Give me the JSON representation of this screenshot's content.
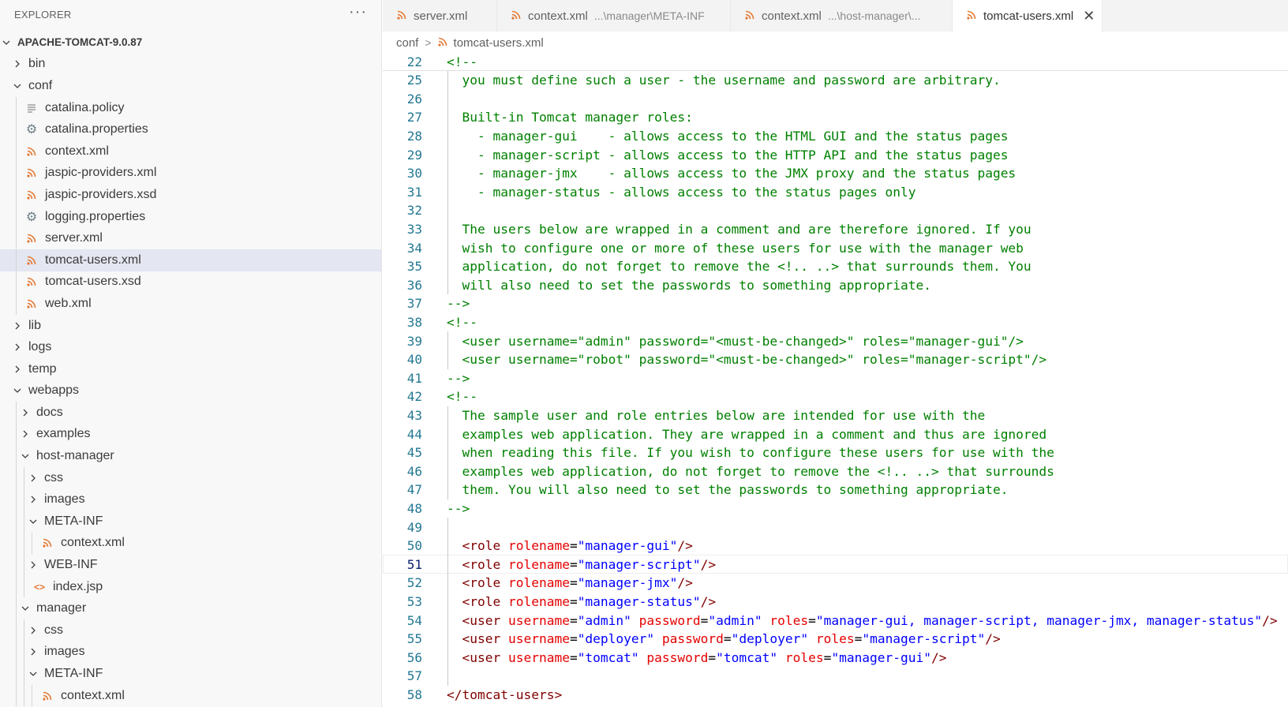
{
  "explorer": {
    "title": "EXPLORER",
    "more_label": "···",
    "items": [
      {
        "label": "APACHE-TOMCAT-9.0.87",
        "depth": 0,
        "type": "folder-open",
        "root": true
      },
      {
        "label": "bin",
        "depth": 1,
        "type": "folder-closed"
      },
      {
        "label": "conf",
        "depth": 1,
        "type": "folder-open"
      },
      {
        "label": "catalina.policy",
        "depth": 2,
        "type": "file",
        "icon": "lines-icon"
      },
      {
        "label": "catalina.properties",
        "depth": 2,
        "type": "file",
        "icon": "gear-icon"
      },
      {
        "label": "context.xml",
        "depth": 2,
        "type": "file",
        "icon": "rss-icon"
      },
      {
        "label": "jaspic-providers.xml",
        "depth": 2,
        "type": "file",
        "icon": "rss-icon"
      },
      {
        "label": "jaspic-providers.xsd",
        "depth": 2,
        "type": "file",
        "icon": "rss-icon"
      },
      {
        "label": "logging.properties",
        "depth": 2,
        "type": "file",
        "icon": "gear-icon"
      },
      {
        "label": "server.xml",
        "depth": 2,
        "type": "file",
        "icon": "rss-icon"
      },
      {
        "label": "tomcat-users.xml",
        "depth": 2,
        "type": "file",
        "icon": "rss-icon",
        "selected": true
      },
      {
        "label": "tomcat-users.xsd",
        "depth": 2,
        "type": "file",
        "icon": "rss-icon"
      },
      {
        "label": "web.xml",
        "depth": 2,
        "type": "file",
        "icon": "rss-icon"
      },
      {
        "label": "lib",
        "depth": 1,
        "type": "folder-closed"
      },
      {
        "label": "logs",
        "depth": 1,
        "type": "folder-closed"
      },
      {
        "label": "temp",
        "depth": 1,
        "type": "folder-closed"
      },
      {
        "label": "webapps",
        "depth": 1,
        "type": "folder-open"
      },
      {
        "label": "docs",
        "depth": 2,
        "type": "folder-closed"
      },
      {
        "label": "examples",
        "depth": 2,
        "type": "folder-closed"
      },
      {
        "label": "host-manager",
        "depth": 2,
        "type": "folder-open"
      },
      {
        "label": "css",
        "depth": 3,
        "type": "folder-closed"
      },
      {
        "label": "images",
        "depth": 3,
        "type": "folder-closed"
      },
      {
        "label": "META-INF",
        "depth": 3,
        "type": "folder-open"
      },
      {
        "label": "context.xml",
        "depth": 4,
        "type": "file",
        "icon": "rss-icon"
      },
      {
        "label": "WEB-INF",
        "depth": 3,
        "type": "folder-closed"
      },
      {
        "label": "index.jsp",
        "depth": 3,
        "type": "file",
        "icon": "code-icon"
      },
      {
        "label": "manager",
        "depth": 2,
        "type": "folder-open"
      },
      {
        "label": "css",
        "depth": 3,
        "type": "folder-closed"
      },
      {
        "label": "images",
        "depth": 3,
        "type": "folder-closed"
      },
      {
        "label": "META-INF",
        "depth": 3,
        "type": "folder-open"
      },
      {
        "label": "context.xml",
        "depth": 4,
        "type": "file",
        "icon": "rss-icon"
      }
    ]
  },
  "tabs": [
    {
      "label": "server.xml",
      "description": "",
      "active": false
    },
    {
      "label": "context.xml",
      "description": "...\\manager\\META-INF",
      "active": false
    },
    {
      "label": "context.xml",
      "description": "...\\host-manager\\...",
      "active": false
    },
    {
      "label": "tomcat-users.xml",
      "description": "",
      "active": true,
      "close": "✕"
    }
  ],
  "breadcrumb": {
    "folder": "conf",
    "separator": ">",
    "file": "tomcat-users.xml"
  },
  "editor": {
    "sticky": {
      "num": "22",
      "segments": [
        {
          "t": "<!--",
          "c": "green"
        }
      ]
    },
    "current_line": "51",
    "lines": [
      {
        "num": "25",
        "segments": [
          {
            "t": "  you must define such a user - the username and password are arbitrary.",
            "c": "green"
          }
        ]
      },
      {
        "num": "26",
        "segments": []
      },
      {
        "num": "27",
        "segments": [
          {
            "t": "  Built-in Tomcat manager roles:",
            "c": "green"
          }
        ]
      },
      {
        "num": "28",
        "segments": [
          {
            "t": "    - manager-gui    - allows access to the HTML GUI and the status pages",
            "c": "green"
          }
        ]
      },
      {
        "num": "29",
        "segments": [
          {
            "t": "    - manager-script - allows access to the HTTP API and the status pages",
            "c": "green"
          }
        ]
      },
      {
        "num": "30",
        "segments": [
          {
            "t": "    - manager-jmx    - allows access to the JMX proxy and the status pages",
            "c": "green"
          }
        ]
      },
      {
        "num": "31",
        "segments": [
          {
            "t": "    - manager-status - allows access to the status pages only",
            "c": "green"
          }
        ]
      },
      {
        "num": "32",
        "segments": []
      },
      {
        "num": "33",
        "segments": [
          {
            "t": "  The users below are wrapped in a comment and are therefore ignored. If you",
            "c": "green"
          }
        ]
      },
      {
        "num": "34",
        "segments": [
          {
            "t": "  wish to configure one or more of these users for use with the manager web",
            "c": "green"
          }
        ]
      },
      {
        "num": "35",
        "segments": [
          {
            "t": "  application, do not forget to remove the <!.. ..> that surrounds them. You",
            "c": "green"
          }
        ]
      },
      {
        "num": "36",
        "segments": [
          {
            "t": "  will also need to set the passwords to something appropriate.",
            "c": "green"
          }
        ]
      },
      {
        "num": "37",
        "segments": [
          {
            "t": "-->",
            "c": "green"
          }
        ]
      },
      {
        "num": "38",
        "segments": [
          {
            "t": "<!--",
            "c": "green"
          }
        ]
      },
      {
        "num": "39",
        "segments": [
          {
            "t": "  <user username=\"admin\" password=\"<must-be-changed>\" roles=\"manager-gui\"/>",
            "c": "green"
          }
        ]
      },
      {
        "num": "40",
        "segments": [
          {
            "t": "  <user username=\"robot\" password=\"<must-be-changed>\" roles=\"manager-script\"/>",
            "c": "green"
          }
        ]
      },
      {
        "num": "41",
        "segments": [
          {
            "t": "-->",
            "c": "green"
          }
        ]
      },
      {
        "num": "42",
        "segments": [
          {
            "t": "<!--",
            "c": "green"
          }
        ]
      },
      {
        "num": "43",
        "segments": [
          {
            "t": "  The sample user and role entries below are intended for use with the",
            "c": "green"
          }
        ]
      },
      {
        "num": "44",
        "segments": [
          {
            "t": "  examples web application. They are wrapped in a comment and thus are ignored",
            "c": "green"
          }
        ]
      },
      {
        "num": "45",
        "segments": [
          {
            "t": "  when reading this file. If you wish to configure these users for use with the",
            "c": "green"
          }
        ]
      },
      {
        "num": "46",
        "segments": [
          {
            "t": "  examples web application, do not forget to remove the <!.. ..> that surrounds",
            "c": "green"
          }
        ]
      },
      {
        "num": "47",
        "segments": [
          {
            "t": "  them. You will also need to set the passwords to something appropriate.",
            "c": "green"
          }
        ]
      },
      {
        "num": "48",
        "segments": [
          {
            "t": "-->",
            "c": "green"
          }
        ]
      },
      {
        "num": "49",
        "segments": []
      },
      {
        "num": "50",
        "segments": [
          {
            "t": "  <role ",
            "c": "tag"
          },
          {
            "t": "rolename",
            "c": "attr"
          },
          {
            "t": "=",
            "c": "plain"
          },
          {
            "t": "\"manager-gui\"",
            "c": "val"
          },
          {
            "t": "/>",
            "c": "tag"
          }
        ]
      },
      {
        "num": "51",
        "segments": [
          {
            "t": "  <role ",
            "c": "tag"
          },
          {
            "t": "rolename",
            "c": "attr"
          },
          {
            "t": "=",
            "c": "plain"
          },
          {
            "t": "\"manager-script\"",
            "c": "val"
          },
          {
            "t": "/>",
            "c": "tag"
          }
        ]
      },
      {
        "num": "52",
        "segments": [
          {
            "t": "  <role ",
            "c": "tag"
          },
          {
            "t": "rolename",
            "c": "attr"
          },
          {
            "t": "=",
            "c": "plain"
          },
          {
            "t": "\"manager-jmx\"",
            "c": "val"
          },
          {
            "t": "/>",
            "c": "tag"
          }
        ]
      },
      {
        "num": "53",
        "segments": [
          {
            "t": "  <role ",
            "c": "tag"
          },
          {
            "t": "rolename",
            "c": "attr"
          },
          {
            "t": "=",
            "c": "plain"
          },
          {
            "t": "\"manager-status\"",
            "c": "val"
          },
          {
            "t": "/>",
            "c": "tag"
          }
        ]
      },
      {
        "num": "54",
        "segments": [
          {
            "t": "  <user ",
            "c": "tag"
          },
          {
            "t": "username",
            "c": "attr"
          },
          {
            "t": "=",
            "c": "plain"
          },
          {
            "t": "\"admin\"",
            "c": "val"
          },
          {
            "t": " ",
            "c": "plain"
          },
          {
            "t": "password",
            "c": "attr"
          },
          {
            "t": "=",
            "c": "plain"
          },
          {
            "t": "\"admin\"",
            "c": "val"
          },
          {
            "t": " ",
            "c": "plain"
          },
          {
            "t": "roles",
            "c": "attr"
          },
          {
            "t": "=",
            "c": "plain"
          },
          {
            "t": "\"manager-gui, manager-script, manager-jmx, manager-status\"",
            "c": "val"
          },
          {
            "t": "/>",
            "c": "tag"
          }
        ]
      },
      {
        "num": "55",
        "segments": [
          {
            "t": "  <user ",
            "c": "tag"
          },
          {
            "t": "username",
            "c": "attr"
          },
          {
            "t": "=",
            "c": "plain"
          },
          {
            "t": "\"deployer\"",
            "c": "val"
          },
          {
            "t": " ",
            "c": "plain"
          },
          {
            "t": "password",
            "c": "attr"
          },
          {
            "t": "=",
            "c": "plain"
          },
          {
            "t": "\"deployer\"",
            "c": "val"
          },
          {
            "t": " ",
            "c": "plain"
          },
          {
            "t": "roles",
            "c": "attr"
          },
          {
            "t": "=",
            "c": "plain"
          },
          {
            "t": "\"manager-script\"",
            "c": "val"
          },
          {
            "t": "/>",
            "c": "tag"
          }
        ]
      },
      {
        "num": "56",
        "segments": [
          {
            "t": "  <user ",
            "c": "tag"
          },
          {
            "t": "username",
            "c": "attr"
          },
          {
            "t": "=",
            "c": "plain"
          },
          {
            "t": "\"tomcat\"",
            "c": "val"
          },
          {
            "t": " ",
            "c": "plain"
          },
          {
            "t": "password",
            "c": "attr"
          },
          {
            "t": "=",
            "c": "plain"
          },
          {
            "t": "\"tomcat\"",
            "c": "val"
          },
          {
            "t": " ",
            "c": "plain"
          },
          {
            "t": "roles",
            "c": "attr"
          },
          {
            "t": "=",
            "c": "plain"
          },
          {
            "t": "\"manager-gui\"",
            "c": "val"
          },
          {
            "t": "/>",
            "c": "tag"
          }
        ]
      },
      {
        "num": "57",
        "segments": []
      },
      {
        "num": "58",
        "segments": [
          {
            "t": "</tomcat-users>",
            "c": "tag"
          }
        ]
      }
    ]
  },
  "colors": {
    "comment": "#008000",
    "tag": "#800000",
    "attribute": "#e50000",
    "value": "#0000ff",
    "line_number": "#237893",
    "xml_icon": "#e37933",
    "selection": "#e4e6f1"
  }
}
